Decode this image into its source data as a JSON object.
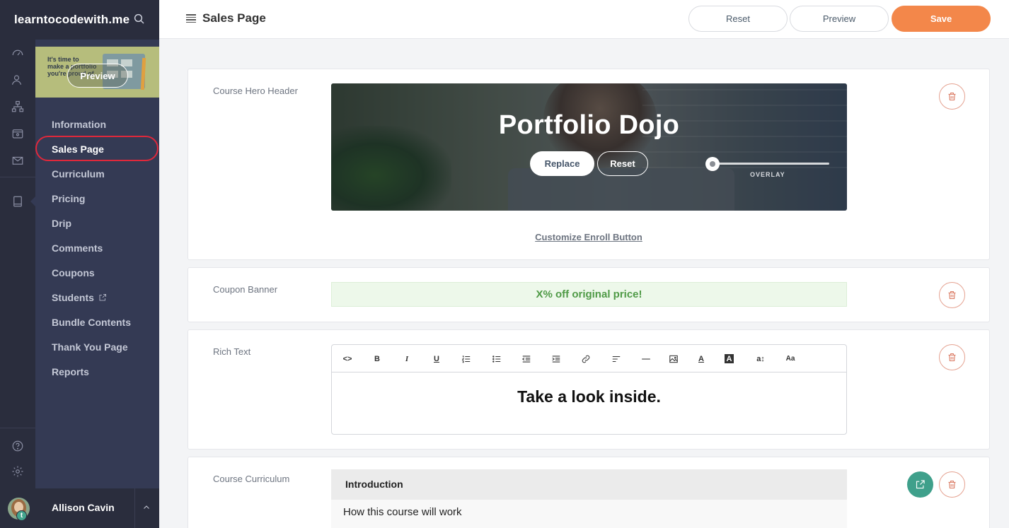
{
  "sidebar": {
    "brand": "learntocodewith.me",
    "preview_thumb": {
      "text": "It's time to make a portfolio you're proud of",
      "button": "Preview"
    },
    "items": [
      {
        "label": "Information"
      },
      {
        "label": "Sales Page",
        "active": true
      },
      {
        "label": "Curriculum"
      },
      {
        "label": "Pricing"
      },
      {
        "label": "Drip"
      },
      {
        "label": "Comments"
      },
      {
        "label": "Coupons"
      },
      {
        "label": "Students",
        "icon": "external-link-icon"
      },
      {
        "label": "Bundle Contents"
      },
      {
        "label": "Thank You Page"
      },
      {
        "label": "Reports"
      }
    ],
    "rail_icons": [
      "dashboard-icon",
      "users-icon",
      "sitemap-icon",
      "wallet-icon",
      "mail-icon",
      "book-icon",
      "help-icon",
      "gear-icon"
    ],
    "user": {
      "name": "Allison Cavin",
      "badge": "t"
    }
  },
  "header": {
    "title": "Sales Page",
    "buttons": {
      "reset": "Reset",
      "preview": "Preview",
      "save": "Save"
    }
  },
  "sections": {
    "hero": {
      "label": "Course Hero Header",
      "title": "Portfolio Dojo",
      "replace_label": "Replace",
      "reset_label": "Reset",
      "overlay_label": "OVERLAY",
      "overlay_value": 0,
      "enroll_link": "Customize Enroll Button"
    },
    "coupon": {
      "label": "Coupon Banner",
      "text": "X% off original price!",
      "color": "#4f9a46"
    },
    "rich_text": {
      "label": "Rich Text",
      "toolbar": [
        "<>",
        "B",
        "I",
        "U",
        "ordered-list-icon",
        "unordered-list-icon",
        "outdent-icon",
        "indent-icon",
        "link-icon",
        "align-icon",
        "hr-icon",
        "image-icon",
        "A",
        "A",
        "a↕",
        "Aa"
      ],
      "content": "Take a look inside."
    },
    "curriculum": {
      "label": "Course Curriculum",
      "chapter": "Introduction",
      "lesson": "How this course will work"
    }
  },
  "colors": {
    "accent": "#f3874a",
    "teal": "#3fa08b",
    "sidebar": "#343a54",
    "rail": "#2a2d3d",
    "highlight": "#e0283b"
  }
}
